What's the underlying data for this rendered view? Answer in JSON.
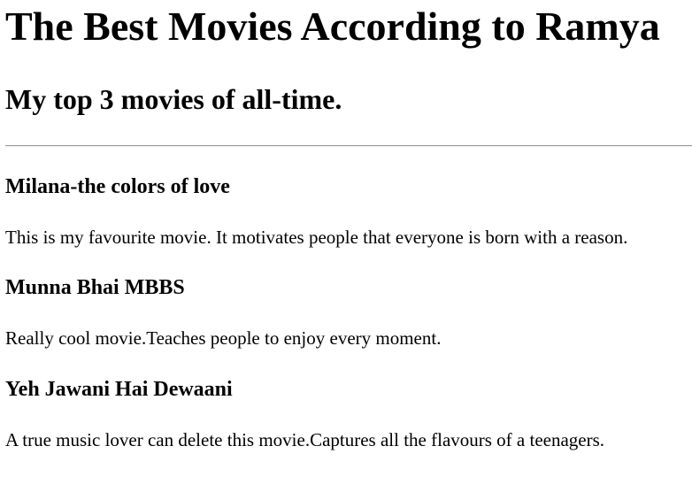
{
  "page": {
    "title": "The Best Movies According to Ramya",
    "subtitle": "My top 3 movies of all-time."
  },
  "movies": [
    {
      "title": "Milana-the colors of love",
      "description": "This is my favourite movie. It motivates people that everyone is born with a reason."
    },
    {
      "title": "Munna Bhai MBBS",
      "description": "Really cool movie.Teaches people to enjoy every moment."
    },
    {
      "title": "Yeh Jawani Hai Dewaani",
      "description": "A true music lover can delete this movie.Captures all the flavours of a teenagers."
    }
  ]
}
